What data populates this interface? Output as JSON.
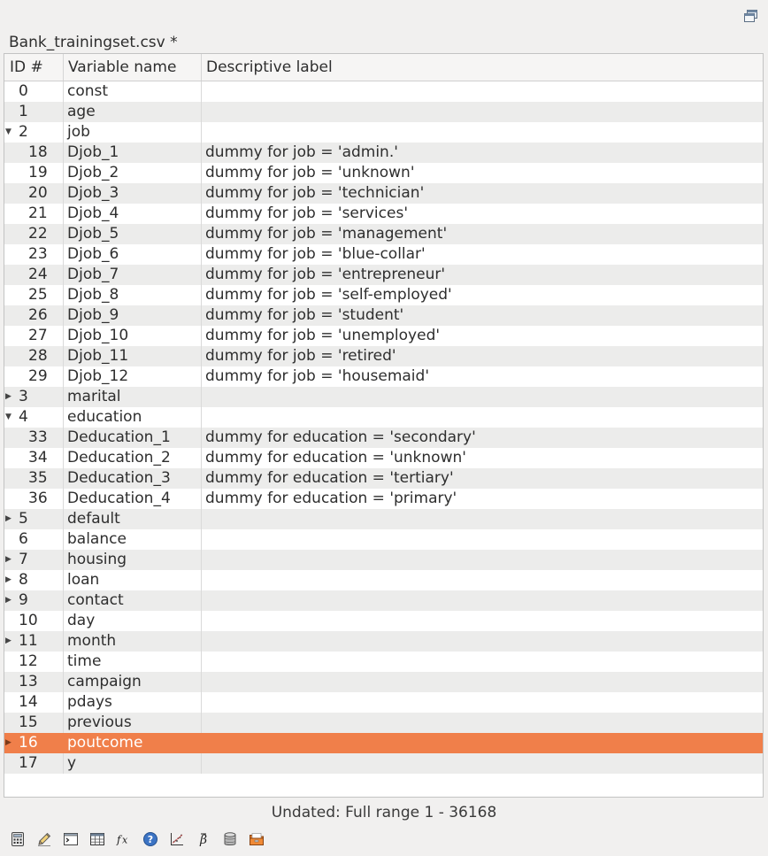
{
  "file_title": "Bank_trainingset.csv *",
  "columns": {
    "id": "ID #",
    "name": "Variable name",
    "label": "Descriptive label"
  },
  "rows": [
    {
      "id": "0",
      "name": "const",
      "label": "",
      "expander": "",
      "indent": 0
    },
    {
      "id": "1",
      "name": "age",
      "label": "",
      "expander": "",
      "indent": 0
    },
    {
      "id": "2",
      "name": "job",
      "label": "",
      "expander": "expanded",
      "indent": 0
    },
    {
      "id": "18",
      "name": "Djob_1",
      "label": "dummy for job = 'admin.'",
      "expander": "",
      "indent": 1
    },
    {
      "id": "19",
      "name": "Djob_2",
      "label": "dummy for job = 'unknown'",
      "expander": "",
      "indent": 1
    },
    {
      "id": "20",
      "name": "Djob_3",
      "label": "dummy for job = 'technician'",
      "expander": "",
      "indent": 1
    },
    {
      "id": "21",
      "name": "Djob_4",
      "label": "dummy for job = 'services'",
      "expander": "",
      "indent": 1
    },
    {
      "id": "22",
      "name": "Djob_5",
      "label": "dummy for job = 'management'",
      "expander": "",
      "indent": 1
    },
    {
      "id": "23",
      "name": "Djob_6",
      "label": "dummy for job = 'blue-collar'",
      "expander": "",
      "indent": 1
    },
    {
      "id": "24",
      "name": "Djob_7",
      "label": "dummy for job = 'entrepreneur'",
      "expander": "",
      "indent": 1
    },
    {
      "id": "25",
      "name": "Djob_8",
      "label": "dummy for job = 'self-employed'",
      "expander": "",
      "indent": 1
    },
    {
      "id": "26",
      "name": "Djob_9",
      "label": "dummy for job = 'student'",
      "expander": "",
      "indent": 1
    },
    {
      "id": "27",
      "name": "Djob_10",
      "label": "dummy for job = 'unemployed'",
      "expander": "",
      "indent": 1
    },
    {
      "id": "28",
      "name": "Djob_11",
      "label": "dummy for job = 'retired'",
      "expander": "",
      "indent": 1
    },
    {
      "id": "29",
      "name": "Djob_12",
      "label": "dummy for job = 'housemaid'",
      "expander": "",
      "indent": 1
    },
    {
      "id": "3",
      "name": "marital",
      "label": "",
      "expander": "collapsed",
      "indent": 0
    },
    {
      "id": "4",
      "name": "education",
      "label": "",
      "expander": "expanded",
      "indent": 0
    },
    {
      "id": "33",
      "name": "Deducation_1",
      "label": "dummy for education = 'secondary'",
      "expander": "",
      "indent": 1
    },
    {
      "id": "34",
      "name": "Deducation_2",
      "label": "dummy for education = 'unknown'",
      "expander": "",
      "indent": 1
    },
    {
      "id": "35",
      "name": "Deducation_3",
      "label": "dummy for education = 'tertiary'",
      "expander": "",
      "indent": 1
    },
    {
      "id": "36",
      "name": "Deducation_4",
      "label": "dummy for education = 'primary'",
      "expander": "",
      "indent": 1
    },
    {
      "id": "5",
      "name": "default",
      "label": "",
      "expander": "collapsed",
      "indent": 0
    },
    {
      "id": "6",
      "name": "balance",
      "label": "",
      "expander": "",
      "indent": 0
    },
    {
      "id": "7",
      "name": "housing",
      "label": "",
      "expander": "collapsed",
      "indent": 0
    },
    {
      "id": "8",
      "name": "loan",
      "label": "",
      "expander": "collapsed",
      "indent": 0
    },
    {
      "id": "9",
      "name": "contact",
      "label": "",
      "expander": "collapsed",
      "indent": 0
    },
    {
      "id": "10",
      "name": "day",
      "label": "",
      "expander": "",
      "indent": 0
    },
    {
      "id": "11",
      "name": "month",
      "label": "",
      "expander": "collapsed",
      "indent": 0
    },
    {
      "id": "12",
      "name": "time",
      "label": "",
      "expander": "",
      "indent": 0
    },
    {
      "id": "13",
      "name": "campaign",
      "label": "",
      "expander": "",
      "indent": 0
    },
    {
      "id": "14",
      "name": "pdays",
      "label": "",
      "expander": "",
      "indent": 0
    },
    {
      "id": "15",
      "name": "previous",
      "label": "",
      "expander": "",
      "indent": 0
    },
    {
      "id": "16",
      "name": "poutcome",
      "label": "",
      "expander": "collapsed",
      "indent": 0,
      "selected": true
    },
    {
      "id": "17",
      "name": "y",
      "label": "",
      "expander": "",
      "indent": 0
    }
  ],
  "status_text": "Undated: Full range 1 - 36168",
  "toolbar_icons": [
    "calculator-icon",
    "edit-pencil-icon",
    "terminal-icon",
    "table-grid-icon",
    "function-fx-icon",
    "help-icon",
    "scatter-plot-icon",
    "beta-model-icon",
    "database-icon",
    "session-icon"
  ],
  "colors": {
    "selected_row": "#f07f4a",
    "alt_row": "#ececeb",
    "background": "#f1f0ef"
  }
}
